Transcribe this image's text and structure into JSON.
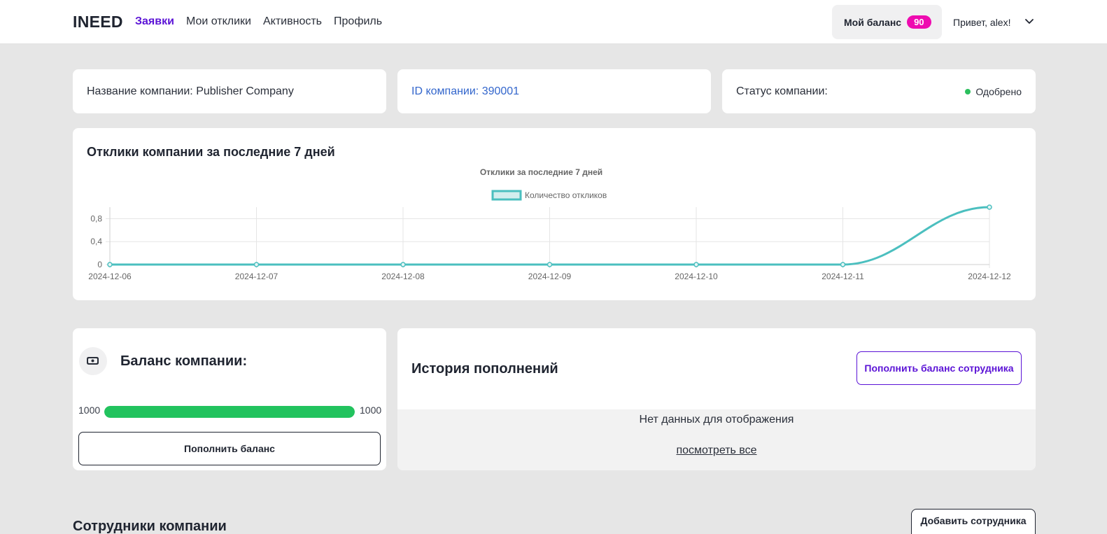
{
  "app": {
    "logo": "INEED"
  },
  "nav": {
    "items": [
      "Заявки",
      "Мои отклики",
      "Активность",
      "Профиль"
    ],
    "active_index": 0
  },
  "header": {
    "balance_label": "Мой баланс",
    "balance_value": "90",
    "greeting": "Привет, alex!"
  },
  "company": {
    "name_text": "Название компании: Publisher Company",
    "id_text": "ID компании: 390001",
    "status_label": "Статус компании:",
    "status_value": "Одобрено",
    "status_color": "#2bbf5d"
  },
  "chart_card": {
    "title": "Отклики компании за последние 7 дней"
  },
  "chart_data": {
    "type": "line",
    "title": "Отклики за последние 7 дней",
    "x": [
      "2024-12-06",
      "2024-12-07",
      "2024-12-08",
      "2024-12-09",
      "2024-12-10",
      "2024-12-11",
      "2024-12-12"
    ],
    "series": [
      {
        "name": "Количество откликов",
        "values": [
          0,
          0,
          0,
          0,
          0,
          0,
          1
        ],
        "color": "#4bbfbf"
      }
    ],
    "ylim": [
      0,
      1
    ],
    "yticks": [
      "0",
      "0,4",
      "0,8"
    ],
    "ytick_values": [
      0,
      0.4,
      0.8
    ],
    "grid": true,
    "legend": "top-center"
  },
  "balance": {
    "title": "Баланс компании:",
    "min_label": "1000",
    "max_label": "1000",
    "fill_fraction": 1.0,
    "fill_color": "#22c35e",
    "button": "Пополнить баланс",
    "icon": "wallet-icon"
  },
  "history": {
    "title": "История пополнений",
    "topup_employee_button": "Пополнить баланс сотрудника",
    "empty_text": "Нет данных для отображения",
    "view_all": "посмотреть все"
  },
  "employees": {
    "title": "Сотрудники компании",
    "add_button": "Добавить сотрудника"
  }
}
